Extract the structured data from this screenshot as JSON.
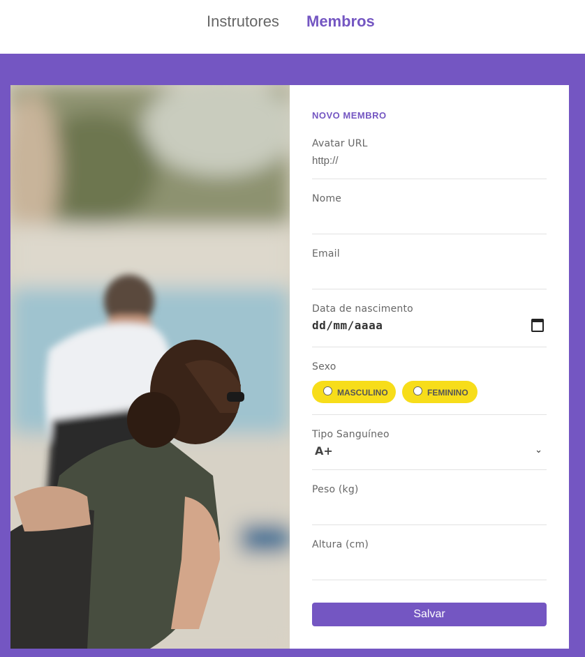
{
  "nav": {
    "items": [
      {
        "label": "Instrutores",
        "active": false
      },
      {
        "label": "Membros",
        "active": true
      }
    ]
  },
  "colors": {
    "accent": "#7456c2",
    "radio_pill": "#f7dd1a",
    "divider": "#e2e2e2"
  },
  "form": {
    "title": "NOVO MEMBRO",
    "avatar": {
      "label": "Avatar URL",
      "value": "http://"
    },
    "nome": {
      "label": "Nome",
      "value": ""
    },
    "email": {
      "label": "Email",
      "value": ""
    },
    "data_nascimento": {
      "label": "Data de nascimento",
      "placeholder": "dd/mm/aaaa",
      "icon": "calendar-icon"
    },
    "sexo": {
      "label": "Sexo",
      "options": [
        "MASCULINO",
        "FEMININO"
      ]
    },
    "tipo_sanguineo": {
      "label": "Tipo Sanguíneo",
      "value": "A+",
      "icon": "chevron-down-icon"
    },
    "peso": {
      "label": "Peso (kg)",
      "value": ""
    },
    "altura": {
      "label": "Altura (cm)",
      "value": ""
    },
    "save_label": "Salvar"
  }
}
